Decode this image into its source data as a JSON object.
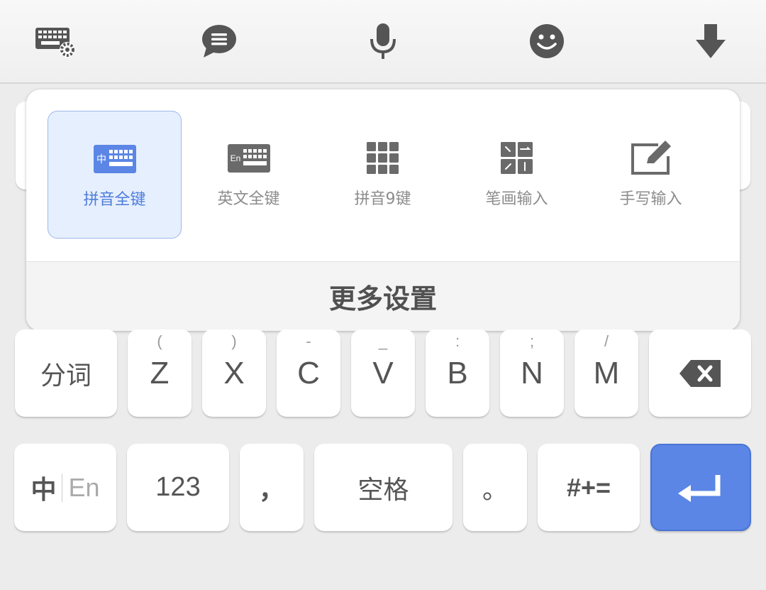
{
  "toolbar": {
    "icons": [
      "keyboard-settings-icon",
      "chat-bubble-icon",
      "microphone-icon",
      "emoji-icon",
      "hide-keyboard-icon"
    ]
  },
  "popup": {
    "layouts": [
      {
        "label": "拼音全键",
        "icon": "pinyin-qwerty-icon",
        "selected": true
      },
      {
        "label": "英文全键",
        "icon": "english-qwerty-icon",
        "selected": false
      },
      {
        "label": "拼音9键",
        "icon": "nine-key-icon",
        "selected": false
      },
      {
        "label": "笔画输入",
        "icon": "stroke-input-icon",
        "selected": false
      },
      {
        "label": "手写输入",
        "icon": "handwriting-icon",
        "selected": false
      }
    ],
    "more_settings": "更多设置",
    "icon_badges": {
      "zh": "中",
      "en": "En"
    }
  },
  "keyboard": {
    "row3": {
      "segment": "分词",
      "letters": [
        {
          "main": "Z",
          "sub": "("
        },
        {
          "main": "X",
          "sub": ")"
        },
        {
          "main": "C",
          "sub": "-"
        },
        {
          "main": "V",
          "sub": "_"
        },
        {
          "main": "B",
          "sub": ":"
        },
        {
          "main": "N",
          "sub": ";"
        },
        {
          "main": "M",
          "sub": "/"
        }
      ]
    },
    "row4": {
      "lang_zh": "中",
      "lang_en": "En",
      "numbers": "123",
      "comma": "，",
      "space": "空格",
      "period": "。",
      "symbols": "#+="
    }
  },
  "colors": {
    "accent": "#5b86e5",
    "selected_bg": "#e6effd",
    "selected_text": "#4d7ddc",
    "icon_gray": "#666666"
  }
}
